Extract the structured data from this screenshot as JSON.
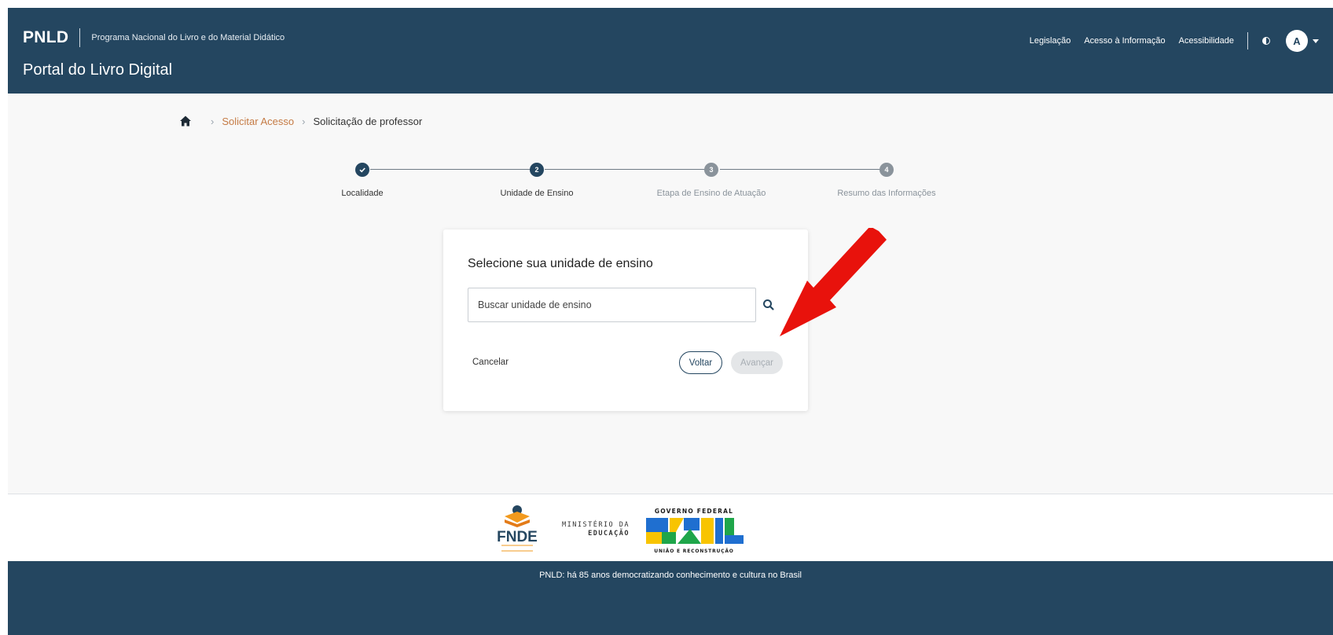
{
  "header": {
    "brand": "PNLD",
    "program": "Programa Nacional do Livro e do Material Didático",
    "portal_title": "Portal do Livro Digital",
    "links": [
      "Legislação",
      "Acesso à Informação",
      "Acessibilidade"
    ],
    "avatar_initial": "A"
  },
  "breadcrumb": {
    "link": "Solicitar Acesso",
    "current": "Solicitação de professor"
  },
  "stepper": {
    "steps": [
      {
        "number": "✓",
        "label": "Localidade",
        "state": "done"
      },
      {
        "number": "2",
        "label": "Unidade de Ensino",
        "state": "active"
      },
      {
        "number": "3",
        "label": "Etapa de Ensino de Atuação",
        "state": "todo"
      },
      {
        "number": "4",
        "label": "Resumo das Informações",
        "state": "todo"
      }
    ]
  },
  "card": {
    "title": "Selecione sua unidade de ensino",
    "search_placeholder": "Buscar unidade de ensino",
    "cancel_label": "Cancelar",
    "back_label": "Voltar",
    "next_label": "Avançar"
  },
  "footer": {
    "ministry_line1": "MINISTÉRIO DA",
    "ministry_line2": "EDUCAÇÃO",
    "gov_top": "GOVERNO FEDERAL",
    "gov_word": "BRASIL",
    "gov_bottom": "UNIÃO E RECONSTRUÇÃO",
    "fnde_word": "FNDE",
    "tagline": "PNLD: há 85 anos democratizando conhecimento e cultura no Brasil"
  },
  "colors": {
    "primary": "#244660",
    "link_orange": "#c57b45",
    "annotation_red": "#e8120c"
  }
}
